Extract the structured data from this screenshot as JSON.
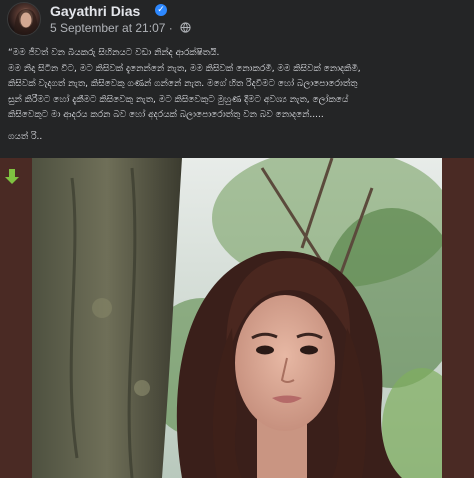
{
  "post": {
    "author": "Gayathri Dias",
    "date": "5 September at 21:07",
    "separator": "·",
    "verified_badge": "✓",
    "privacy_icon": "globe-icon",
    "text_lines": [
      "“මම ජීවත් වන බියකරු සිහිනයට වඩා නින්ද ආරක්ෂිතයි.",
      "මම නිදා සිටින විට, මට කිසිවක් දැනෙන්නේ නැත, මම කිසිවක් නොකරමි, මම කිසිවක් නොදකිමි,",
      "කිසිවක් වැදගත් නැත, කිසිවෙකු ගණන් ගන්නේ නැත.  මගේ හිත රිදවීමට හෝ බලාපොරොත්තු",
      "සුන් කිරීමට හෝ දැකීමට කිසිවෙකු නැත, මට කිසිවෙකුට මුහුණ දීමට අවශ්‍ය නැත, ලෝකයේ",
      "කිසිවෙකුට මා ආදරය කරන බව හෝ අදරයක් බලාපොරොත්තු වන බව නොදනේ.....",
      "ගයත් රි.."
    ]
  },
  "media": {
    "download_icon": "down-arrow-icon",
    "photo_alt": "Selfie of a woman with long dark hair standing beside a tree trunk",
    "colors": {
      "background": "#242526",
      "accent": "#2d88ff",
      "download_icon": "#7fc241"
    }
  }
}
